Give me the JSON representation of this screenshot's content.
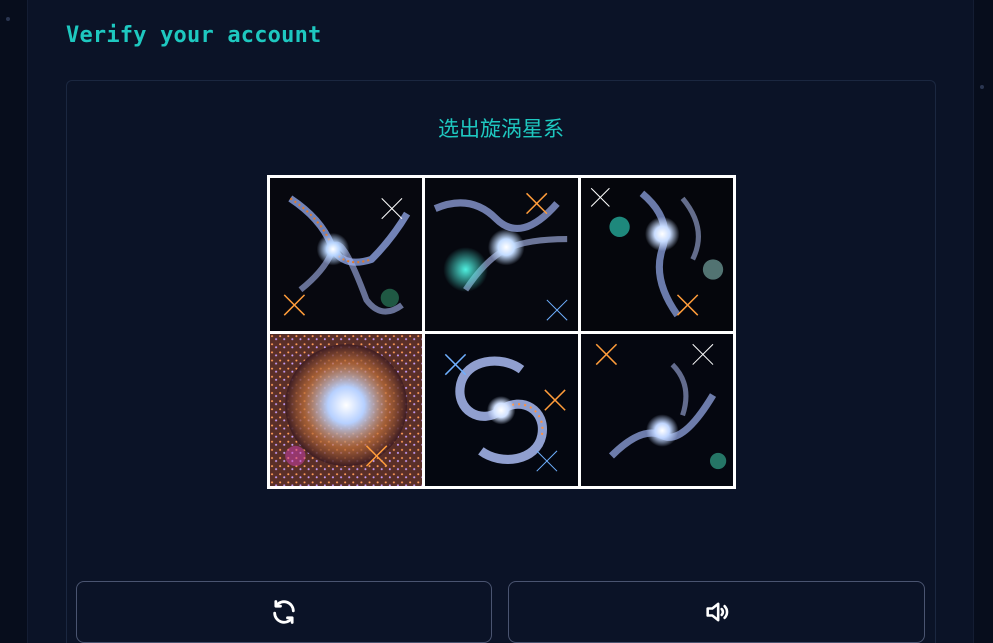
{
  "header": {
    "title": "Verify your account"
  },
  "challenge": {
    "prompt": "选出旋涡星系",
    "tiles": [
      {
        "type": "irregular"
      },
      {
        "type": "irregular"
      },
      {
        "type": "irregular"
      },
      {
        "type": "elliptical"
      },
      {
        "type": "spiral"
      },
      {
        "type": "irregular"
      }
    ]
  },
  "controls": {
    "refresh_icon": "refresh-icon",
    "audio_icon": "speaker-icon"
  },
  "colors": {
    "accent": "#1ec8c0",
    "background": "#0b1327",
    "border": "#4a5470"
  }
}
